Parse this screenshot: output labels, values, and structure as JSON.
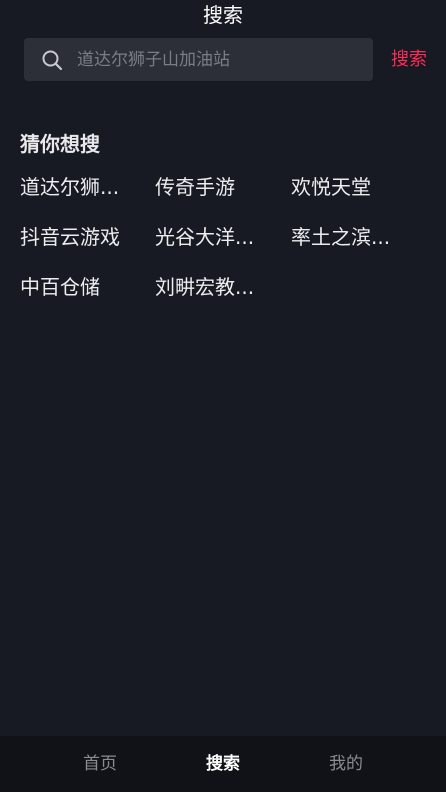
{
  "header": {
    "title": "搜索"
  },
  "search": {
    "placeholder": "道达尔狮子山加油站",
    "value": "",
    "button_label": "搜索"
  },
  "suggestions": {
    "title": "猜你想搜",
    "items": [
      {
        "label": "道达尔狮..."
      },
      {
        "label": "传奇手游"
      },
      {
        "label": "欢悦天堂"
      },
      {
        "label": "抖音云游戏"
      },
      {
        "label": "光谷大洋..."
      },
      {
        "label": "率土之滨..."
      },
      {
        "label": "中百仓储"
      },
      {
        "label": "刘畊宏教..."
      }
    ]
  },
  "tabbar": {
    "tabs": [
      {
        "label": "首页",
        "active": false
      },
      {
        "label": "搜索",
        "active": true
      },
      {
        "label": "我的",
        "active": false
      }
    ]
  },
  "colors": {
    "background": "#171923",
    "accent": "#fe2c55",
    "search_box": "#2c2e38"
  },
  "icons": {
    "search": "search-icon"
  }
}
